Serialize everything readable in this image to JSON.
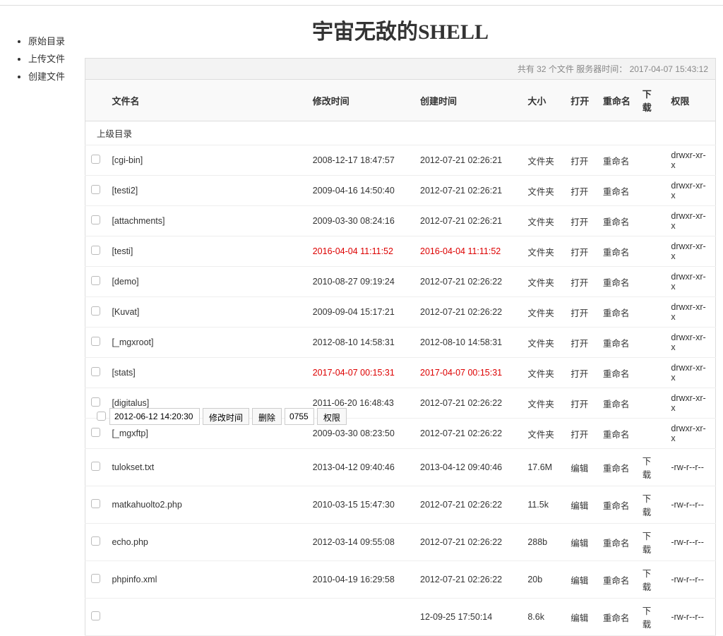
{
  "title": "宇宙无敌的SHELL",
  "sidebar": {
    "items": [
      {
        "label": "原始目录"
      },
      {
        "label": "上传文件"
      },
      {
        "label": "创建文件"
      }
    ]
  },
  "status": {
    "prefix": "共有",
    "count": "32",
    "suffix_files": "个文件 服务器时间：",
    "server_time": "2017-04-07 15:43:12"
  },
  "headers": {
    "name": "文件名",
    "mtime": "修改时间",
    "ctime": "创建时间",
    "size": "大小",
    "open": "打开",
    "rename": "重命名",
    "download": "下载",
    "perm": "权限"
  },
  "parent_dir_label": "上级目录",
  "rows": [
    {
      "name": "[cgi-bin]",
      "mtime": "2008-12-17 18:47:57",
      "ctime": "2012-07-21 02:26:21",
      "size": "文件夹",
      "open": "打开",
      "rename": "重命名",
      "download": "",
      "perm": "drwxr-xr-x",
      "red": false
    },
    {
      "name": "[testi2]",
      "mtime": "2009-04-16 14:50:40",
      "ctime": "2012-07-21 02:26:21",
      "size": "文件夹",
      "open": "打开",
      "rename": "重命名",
      "download": "",
      "perm": "drwxr-xr-x",
      "red": false
    },
    {
      "name": "[attachments]",
      "mtime": "2009-03-30 08:24:16",
      "ctime": "2012-07-21 02:26:21",
      "size": "文件夹",
      "open": "打开",
      "rename": "重命名",
      "download": "",
      "perm": "drwxr-xr-x",
      "red": false
    },
    {
      "name": "[testi]",
      "mtime": "2016-04-04 11:11:52",
      "ctime": "2016-04-04 11:11:52",
      "size": "文件夹",
      "open": "打开",
      "rename": "重命名",
      "download": "",
      "perm": "drwxr-xr-x",
      "red": true
    },
    {
      "name": "[demo]",
      "mtime": "2010-08-27 09:19:24",
      "ctime": "2012-07-21 02:26:22",
      "size": "文件夹",
      "open": "打开",
      "rename": "重命名",
      "download": "",
      "perm": "drwxr-xr-x",
      "red": false
    },
    {
      "name": "[Kuvat]",
      "mtime": "2009-09-04 15:17:21",
      "ctime": "2012-07-21 02:26:22",
      "size": "文件夹",
      "open": "打开",
      "rename": "重命名",
      "download": "",
      "perm": "drwxr-xr-x",
      "red": false
    },
    {
      "name": "[_mgxroot]",
      "mtime": "2012-08-10 14:58:31",
      "ctime": "2012-08-10 14:58:31",
      "size": "文件夹",
      "open": "打开",
      "rename": "重命名",
      "download": "",
      "perm": "drwxr-xr-x",
      "red": false
    },
    {
      "name": "[stats]",
      "mtime": "2017-04-07 00:15:31",
      "ctime": "2017-04-07 00:15:31",
      "size": "文件夹",
      "open": "打开",
      "rename": "重命名",
      "download": "",
      "perm": "drwxr-xr-x",
      "red": true
    },
    {
      "name": "[digitalus]",
      "mtime": "2011-06-20 16:48:43",
      "ctime": "2012-07-21 02:26:22",
      "size": "文件夹",
      "open": "打开",
      "rename": "重命名",
      "download": "",
      "perm": "drwxr-xr-x",
      "red": false
    },
    {
      "name": "[_mgxftp]",
      "mtime": "2009-03-30 08:23:50",
      "ctime": "2012-07-21 02:26:22",
      "size": "文件夹",
      "open": "打开",
      "rename": "重命名",
      "download": "",
      "perm": "drwxr-xr-x",
      "red": false
    },
    {
      "name": "tulokset.txt",
      "mtime": "2013-04-12 09:40:46",
      "ctime": "2013-04-12 09:40:46",
      "size": "17.6M",
      "open": "编辑",
      "rename": "重命名",
      "download": "下载",
      "perm": "-rw-r--r--",
      "red": false
    },
    {
      "name": "matkahuolto2.php",
      "mtime": "2010-03-15 15:47:30",
      "ctime": "2012-07-21 02:26:22",
      "size": "11.5k",
      "open": "编辑",
      "rename": "重命名",
      "download": "下载",
      "perm": "-rw-r--r--",
      "red": false
    },
    {
      "name": "echo.php",
      "mtime": "2012-03-14 09:55:08",
      "ctime": "2012-07-21 02:26:22",
      "size": "288b",
      "open": "编辑",
      "rename": "重命名",
      "download": "下载",
      "perm": "-rw-r--r--",
      "red": false
    },
    {
      "name": "phpinfo.xml",
      "mtime": "2010-04-19 16:29:58",
      "ctime": "2012-07-21 02:26:22",
      "size": "20b",
      "open": "编辑",
      "rename": "重命名",
      "download": "下载",
      "perm": "-rw-r--r--",
      "red": false
    },
    {
      "name": "",
      "mtime": "",
      "ctime": "12-09-25 17:50:14",
      "size": "8.6k",
      "open": "编辑",
      "rename": "重命名",
      "download": "下载",
      "perm": "-rw-r--r--",
      "red": false
    }
  ],
  "bottom": {
    "mtime_value": "2012-06-12 14:20:30",
    "btn_mtime": "修改时间",
    "btn_delete": "删除",
    "perm_value": "0755",
    "btn_perm": "权限"
  }
}
